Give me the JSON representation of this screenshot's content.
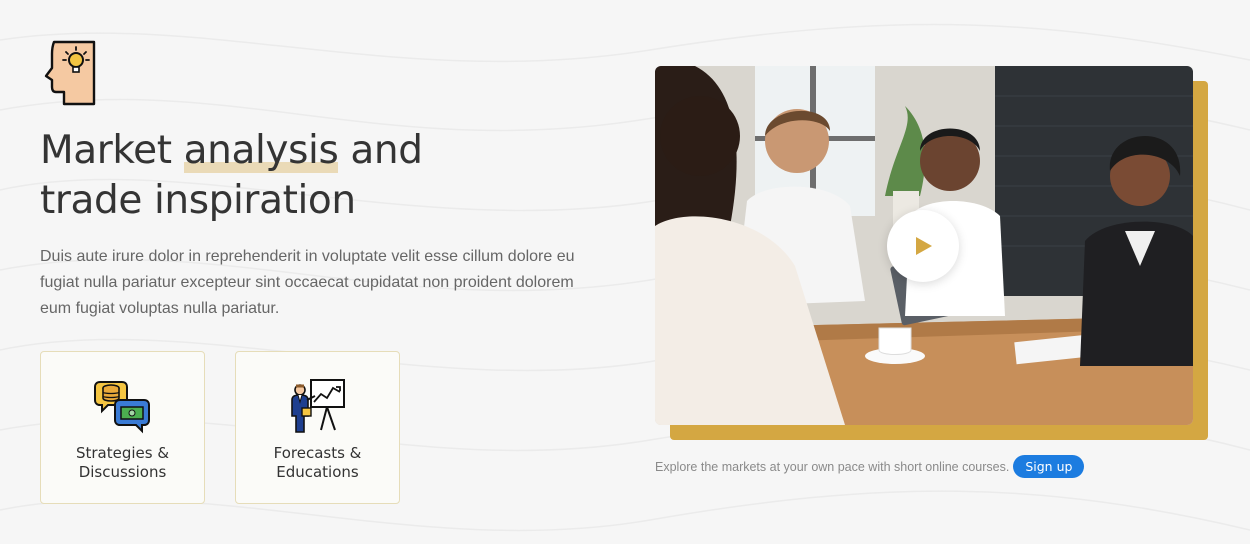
{
  "hero": {
    "title_pre": "Market ",
    "title_highlight": "analysis",
    "title_post": " and",
    "title_line2": "trade inspiration",
    "description": "Duis aute irure dolor in reprehenderit in voluptate velit esse cillum dolore eu fugiat nulla pariatur excepteur sint occaecat cupidatat non proident dolorem eum fugiat voluptas nulla pariatur.",
    "icon": "head-lightbulb-icon"
  },
  "cards": [
    {
      "label": "Strategies &\nDiscussions",
      "icon": "chat-coins-icon"
    },
    {
      "label": "Forecasts &\nEducations",
      "icon": "presentation-chart-icon"
    }
  ],
  "media": {
    "image": "business-meeting-photo",
    "play_icon": "play-icon"
  },
  "cta": {
    "text": "Explore the markets at your own pace with short online courses.",
    "button_label": "Sign up"
  },
  "colors": {
    "accent_gold": "#d4a742",
    "button_blue": "#1c7ce0",
    "background": "#f6f6f6"
  }
}
